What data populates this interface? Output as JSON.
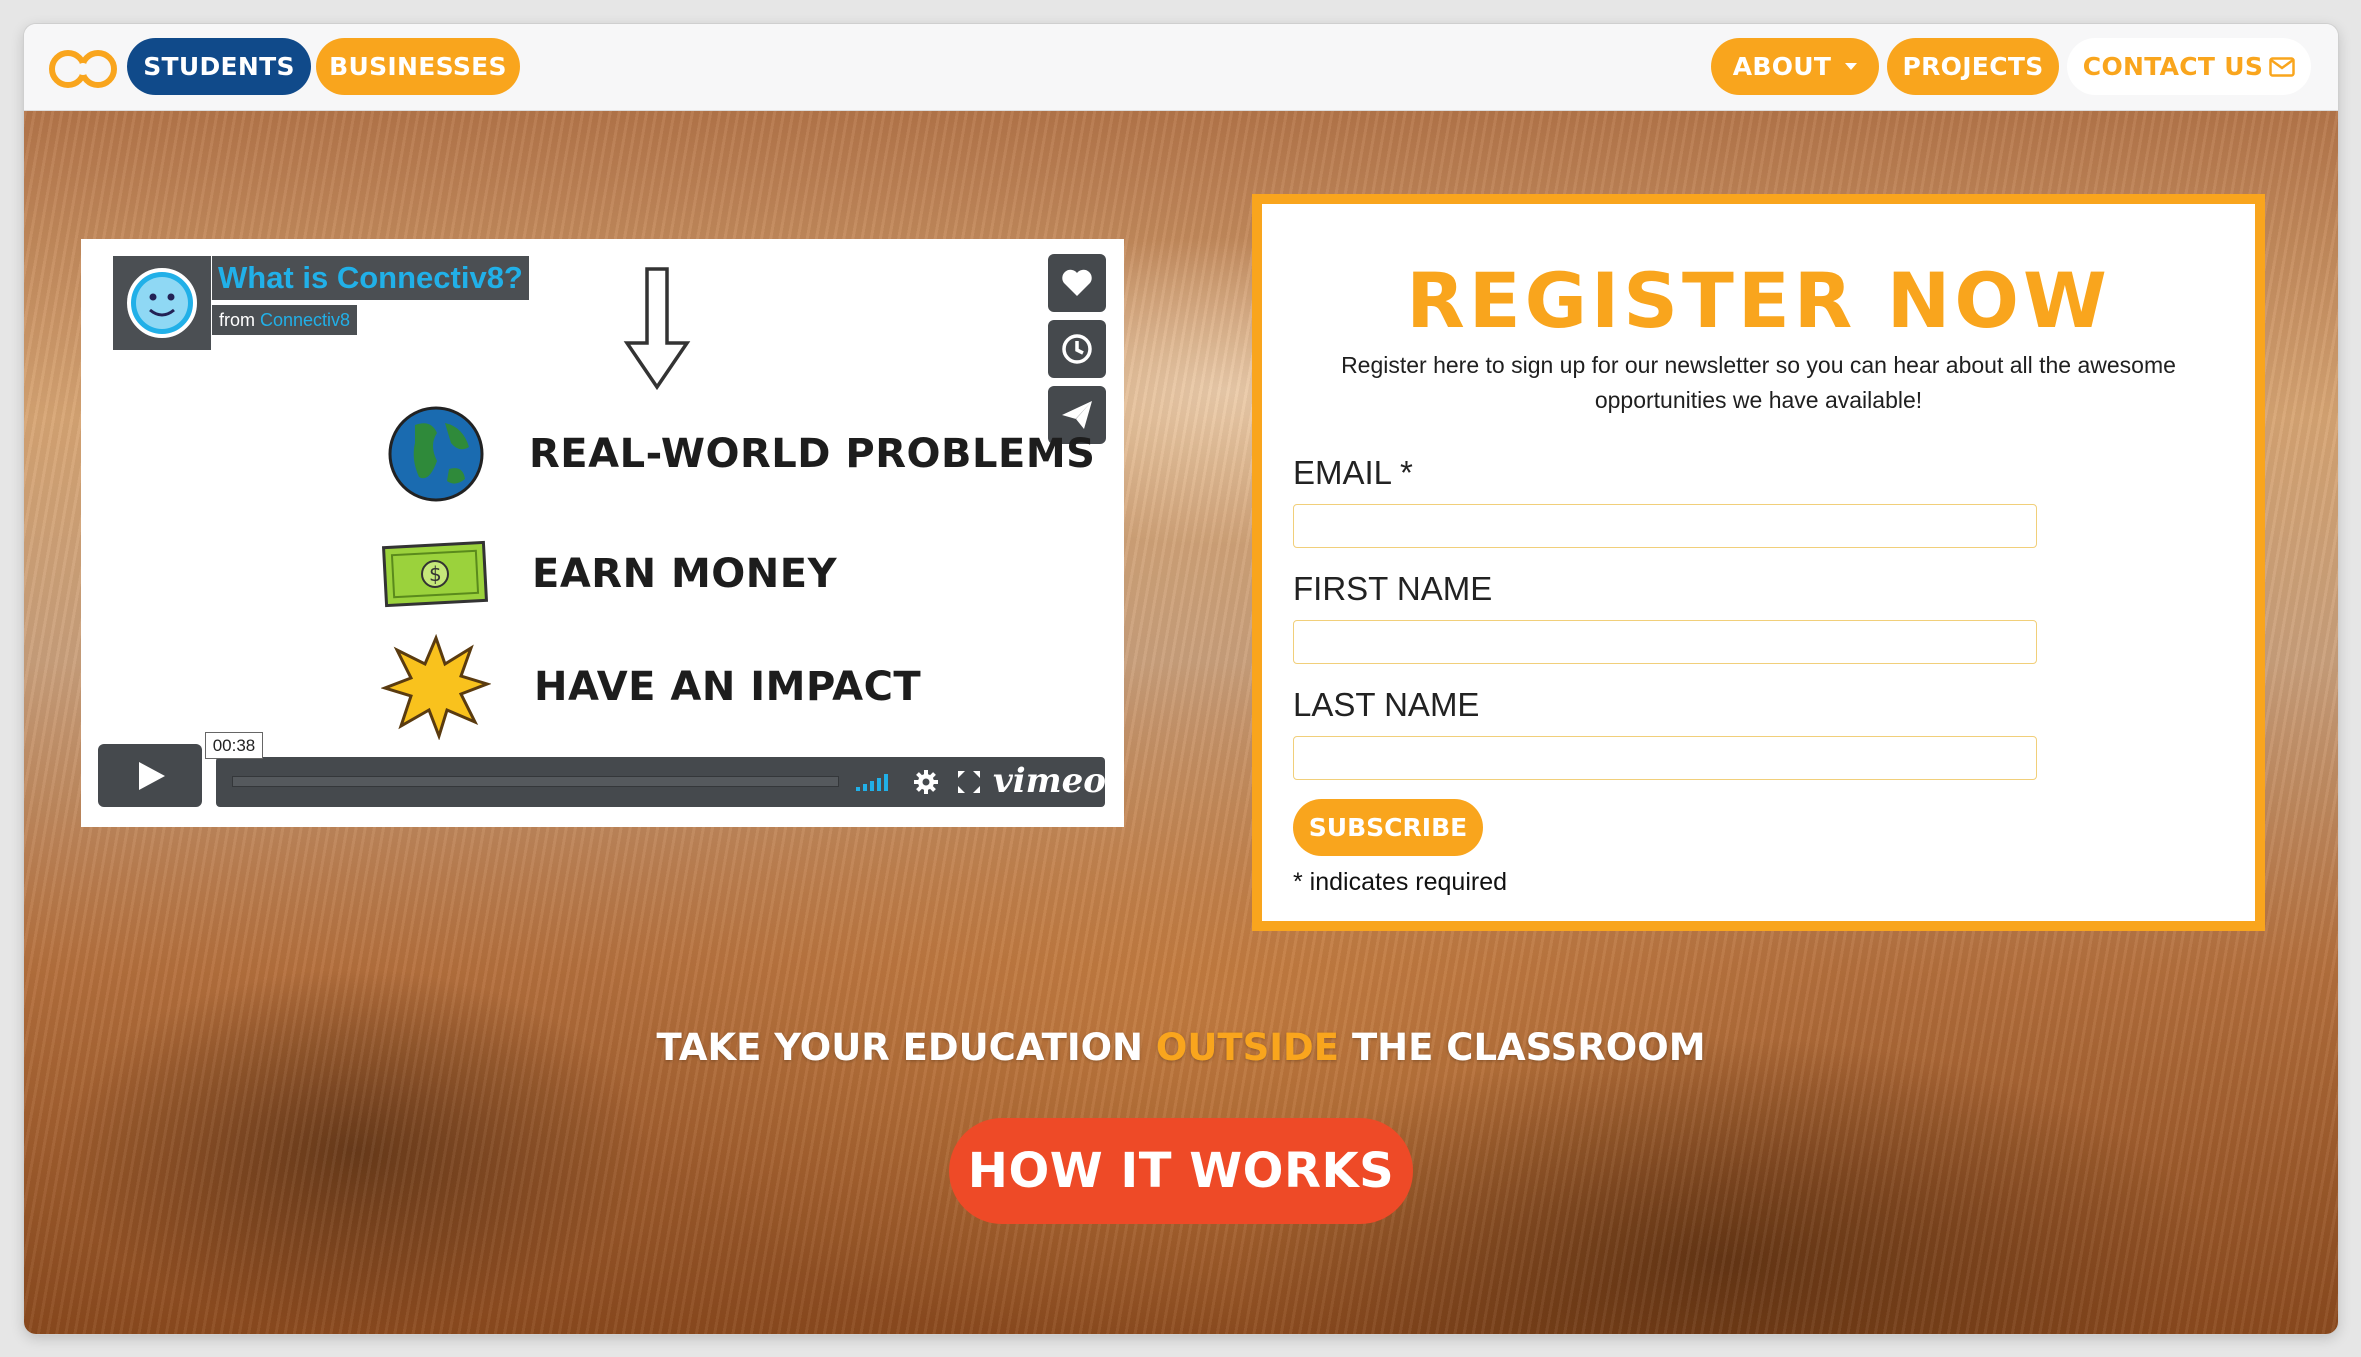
{
  "nav": {
    "students": "STUDENTS",
    "businesses": "BUSINESSES",
    "about": "ABOUT",
    "projects": "PROJECTS",
    "contact": "CONTACT US"
  },
  "video": {
    "title": "What is Connectiv8?",
    "from_prefix": "from",
    "from_name": "Connectiv8",
    "items": [
      {
        "label": "REAL-WORLD PROBLEMS",
        "icon": "globe-icon"
      },
      {
        "label": "EARN MONEY",
        "icon": "money-icon"
      },
      {
        "label": "HAVE AN IMPACT",
        "icon": "starburst-icon"
      }
    ],
    "time": "00:38",
    "brand": "vimeo"
  },
  "register": {
    "title": "REGISTER NOW",
    "description": "Register here to sign up for our newsletter so you can hear about all the awesome opportunities we have available!",
    "email_label": "EMAIL *",
    "first_name_label": "FIRST NAME",
    "last_name_label": "LAST NAME",
    "email_value": "",
    "first_name_value": "",
    "last_name_value": "",
    "subscribe": "SUBSCRIBE",
    "required_note": "* indicates required"
  },
  "hero": {
    "tagline_pre": "TAKE YOUR EDUCATION",
    "tagline_highlight": "OUTSIDE",
    "tagline_post": "THE CLASSROOM",
    "cta": "HOW IT WORKS"
  },
  "colors": {
    "orange": "#f9a51d",
    "navy": "#104a8a",
    "cta_red": "#ee4a27"
  }
}
